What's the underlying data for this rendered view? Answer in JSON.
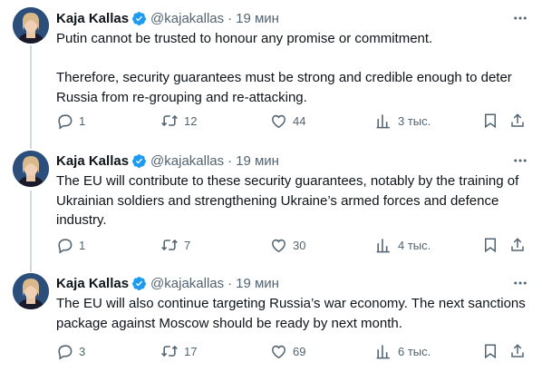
{
  "colors": {
    "text_primary": "#0f1419",
    "text_secondary": "#536471",
    "verified_blue": "#1d9bf0",
    "thread_line": "#cfd9de"
  },
  "icons": {
    "verified": "verified-badge-icon",
    "more": "more-horizontal-icon",
    "reply": "reply-icon",
    "retweet": "retweet-icon",
    "like": "heart-icon",
    "views": "views-bar-chart-icon",
    "bookmark": "bookmark-icon",
    "share": "share-icon"
  },
  "tweets": [
    {
      "author": {
        "name": "Kaja Kallas",
        "handle": "@kajakallas"
      },
      "separator": "·",
      "time": "19 мин",
      "text": "Putin cannot be trusted to honour any promise or commitment.\n\nTherefore, security guarantees must be strong and credible enough to deter Russia from re-grouping and re-attacking.",
      "stats": {
        "replies": "1",
        "reposts": "12",
        "likes": "44",
        "views": "3 тыс."
      }
    },
    {
      "author": {
        "name": "Kaja Kallas",
        "handle": "@kajakallas"
      },
      "separator": "·",
      "time": "19 мин",
      "text": "The EU will contribute to these security guarantees, notably by the training of Ukrainian soldiers and strengthening Ukraine’s armed forces and defence industry.",
      "stats": {
        "replies": "1",
        "reposts": "7",
        "likes": "30",
        "views": "4 тыс."
      }
    },
    {
      "author": {
        "name": "Kaja Kallas",
        "handle": "@kajakallas"
      },
      "separator": "·",
      "time": "19 мин",
      "text": "The EU will also continue targeting Russia’s war economy. The next sanctions package against Moscow should be ready by next month.",
      "stats": {
        "replies": "3",
        "reposts": "17",
        "likes": "69",
        "views": "6 тыс."
      }
    }
  ]
}
